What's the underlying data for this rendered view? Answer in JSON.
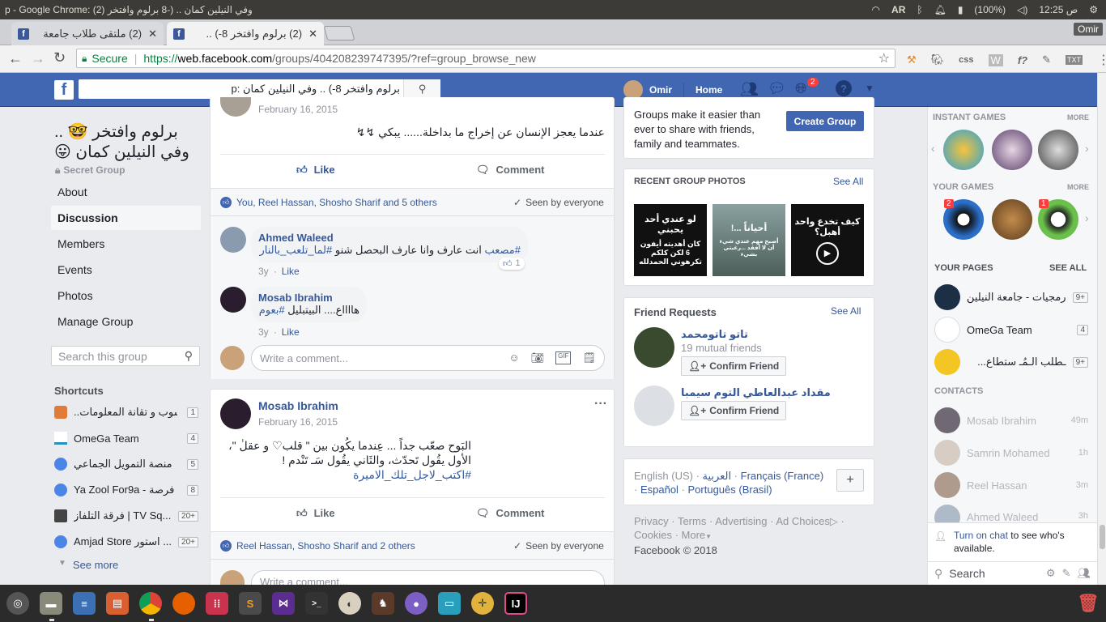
{
  "system": {
    "window_title": "p - Google Chrome: وفي النيلين كمان .. (-8 برلوم وافتخر (2)",
    "keyboard": "AR",
    "battery": "(100%)",
    "time": "12:25 ص"
  },
  "browser": {
    "tabs": [
      {
        "label": "(2) ملتقى طلاب جامعة"
      },
      {
        "label": "(2) برلوم وافتخر 8-) .."
      }
    ],
    "profile": "Omir",
    "secure_label": "Secure",
    "url_scheme": "https://",
    "url_host": "web.facebook.com",
    "url_path": "/groups/404208239747395/?ref=group_browse_new"
  },
  "fb_header": {
    "search_value": "برلوم وافتخر 8-) .. وفي النيلين كمان :p",
    "user": "Omir",
    "home": "Home",
    "notif_count": "2"
  },
  "group": {
    "name_line1": "برلوم وافتخر 🤓 ..",
    "name_line2": "وفي النيلين كمان 😛",
    "privacy": "Secret Group",
    "nav": [
      "About",
      "Discussion",
      "Members",
      "Events",
      "Photos",
      "Manage Group"
    ],
    "search_placeholder": "Search this group"
  },
  "shortcuts": {
    "title": "Shortcuts",
    "items": [
      {
        "label": "..سوب و تقانة المعلومات",
        "count": "1"
      },
      {
        "label": "OmeGa Team",
        "count": "4"
      },
      {
        "label": "منصة التمويل الجماعي",
        "count": "5"
      },
      {
        "label": "Ya Zool For9a - فرصة",
        "count": "8"
      },
      {
        "label": "فرقة التلفاز | TV Sq...",
        "count": "20+"
      },
      {
        "label": "Amjad Store استور ...",
        "count": "20+"
      }
    ],
    "see_more": "See more"
  },
  "post1": {
    "date": "February 16, 2015",
    "text": "عندما يعجز الإنسان عن إخراج ما بداخلة...... يبكي ↯↯",
    "like": "Like",
    "comment": "Comment",
    "reactions": "You, Reel Hassan, Shosho Sharif and 5 others",
    "seen": "Seen by everyone",
    "comments": [
      {
        "author": "Ahmed Waleed",
        "tag": "#مصعب",
        "text": " انت عارف وانا عارف البحصل شنو ",
        "tag2": "#لما_تلعب_بالنار",
        "time": "3y",
        "action": "Like",
        "likes": "1"
      },
      {
        "author": "Mosab Ibrahim",
        "text": "هااااع.... البيتبليل ",
        "tag": "#بعوم",
        "time": "3y",
        "action": "Like"
      }
    ],
    "write_placeholder": "Write a comment..."
  },
  "post2": {
    "author": "Mosab Ibrahim",
    "date": "February 16, 2015",
    "line1": "البَوح صعّب جداً ... عِندما يكُون بين \" قلب♡ و عقلٰ \"،",
    "line2": "الأول يقُول تَحدّث، والثَاني يقُول سَـ تَنْدم !",
    "hashtag": "#اكتب_لاجل_تلك_الاميرة",
    "like": "Like",
    "comment": "Comment",
    "reactions": "Reel Hassan, Shosho Sharif and 2 others",
    "seen": "Seen by everyone",
    "write_placeholder": "Write a comment..."
  },
  "groups_promo": {
    "text": "Groups make it easier than ever to share with friends, family and teammates.",
    "button": "Create Group"
  },
  "recent_photos": {
    "title": "RECENT GROUP PHOTOS",
    "see_all": "See All",
    "photos": [
      {
        "line1": "لو عندي أحد يحبني",
        "line2": "كان أهديته أيفون 6 لكن كلكم تكرهوني الحمدلله"
      },
      {
        "line1": "أحياناً ...!",
        "line2": "أصبح مهم عندي شيء أن لا أفقد ...رغبتي بشيء"
      },
      {
        "line1": "كيف تخدع واحد أهبل؟",
        "line2": ""
      }
    ]
  },
  "friend_requests": {
    "title": "Friend Requests",
    "see_all": "See All",
    "items": [
      {
        "name": "تاتو تاتومحمد",
        "mutual": "19 mutual friends",
        "button": "Confirm Friend"
      },
      {
        "name": "مقداد عبدالعاطي التوم سيمبا",
        "button": "Confirm Friend"
      }
    ]
  },
  "languages": {
    "current": "English (US)",
    "others": [
      "العربية",
      "Français (France)",
      "Español",
      "Português (Brasil)"
    ]
  },
  "footer": {
    "links": [
      "Privacy",
      "Terms",
      "Advertising",
      "Ad Choices",
      "Cookies",
      "More"
    ],
    "copyright": "Facebook © 2018"
  },
  "sidebar": {
    "instant_games": "INSTANT GAMES",
    "your_games": "YOUR GAMES",
    "more": "MORE",
    "game_badges": [
      "2",
      "1"
    ],
    "your_pages": "YOUR PAGES",
    "see_all": "SEE ALL",
    "pages": [
      {
        "name": "رمجيات - جامعة النيلين",
        "count": "9+"
      },
      {
        "name": "OmeGa Team",
        "count": "4"
      },
      {
        "name": "ـطلب الـمُـ ستطاع...",
        "count": "9+"
      }
    ],
    "contacts_title": "CONTACTS",
    "contacts": [
      {
        "name": "Mosab Ibrahim",
        "time": "49m"
      },
      {
        "name": "Samrin Mohamed",
        "time": "1h"
      },
      {
        "name": "Reel Hassan",
        "time": "3m"
      },
      {
        "name": "Ahmed Waleed",
        "time": "3h"
      }
    ],
    "turn_on_chat": "Turn on chat",
    "turn_on_chat_rest": " to see who's available.",
    "search": "Search"
  },
  "colors": {
    "fb_blue": "#4267b2",
    "link": "#365899",
    "sysbar": "#3c3b37"
  }
}
